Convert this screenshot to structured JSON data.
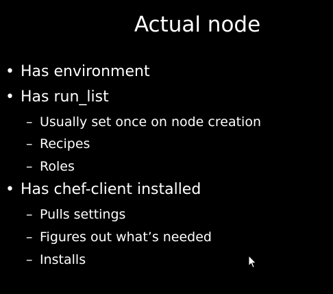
{
  "slide": {
    "title": "Actual node",
    "bullet_glyph": "•",
    "dash_glyph": "–",
    "items": [
      {
        "text": "Has environment",
        "subitems": []
      },
      {
        "text": "Has run_list",
        "subitems": [
          "Usually set once on node creation",
          "Recipes",
          "Roles"
        ]
      },
      {
        "text": "Has chef-client installed",
        "subitems": [
          "Pulls settings",
          "Figures out what’s needed",
          "Installs"
        ]
      }
    ]
  },
  "colors": {
    "background": "#000000",
    "text": "#ffffff"
  },
  "icons": {
    "cursor": "mouse-pointer-icon"
  }
}
